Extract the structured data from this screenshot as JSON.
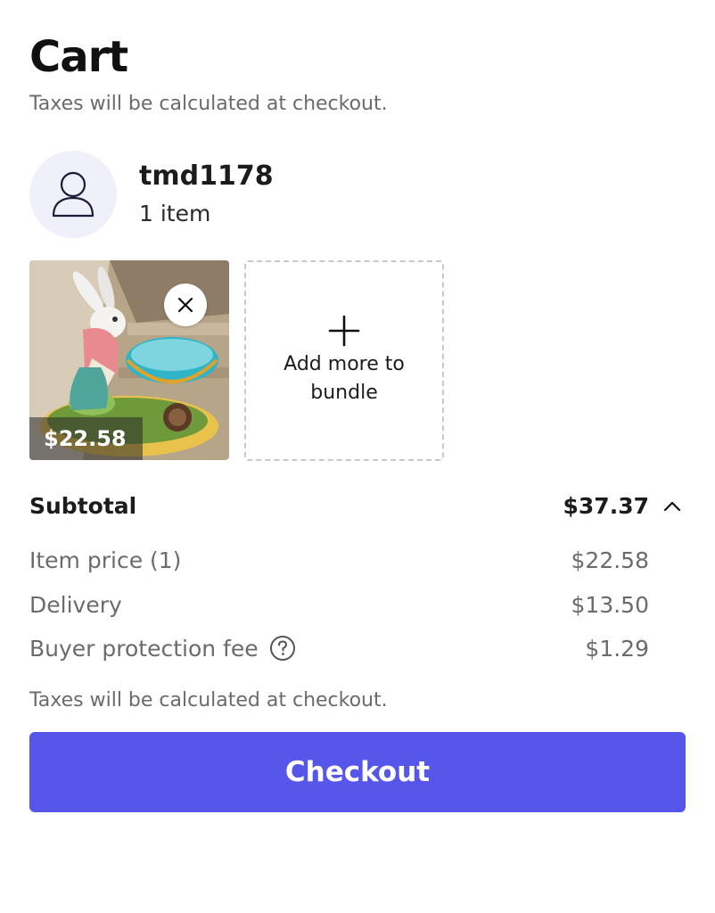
{
  "header": {
    "title": "Cart",
    "tax_note": "Taxes will be calculated at checkout."
  },
  "seller": {
    "name": "tmd1178",
    "item_count": "1 item",
    "avatar_icon": "user-outline-icon"
  },
  "bundle": {
    "items": [
      {
        "price": "$22.58",
        "remove_icon": "close-icon"
      }
    ],
    "add_more_label": "Add more to bundle",
    "add_icon": "plus-icon"
  },
  "summary": {
    "subtotal_label": "Subtotal",
    "subtotal_value": "$37.37",
    "toggle_icon": "chevron-up-icon",
    "lines": [
      {
        "label": "Item price (1)",
        "value": "$22.58"
      },
      {
        "label": "Delivery",
        "value": "$13.50"
      },
      {
        "label": "Buyer protection fee",
        "value": "$1.29",
        "icon": "question-circle-icon"
      }
    ],
    "tax_note": "Taxes will be calculated at checkout."
  },
  "checkout": {
    "label": "Checkout",
    "color": "#5656eb"
  }
}
